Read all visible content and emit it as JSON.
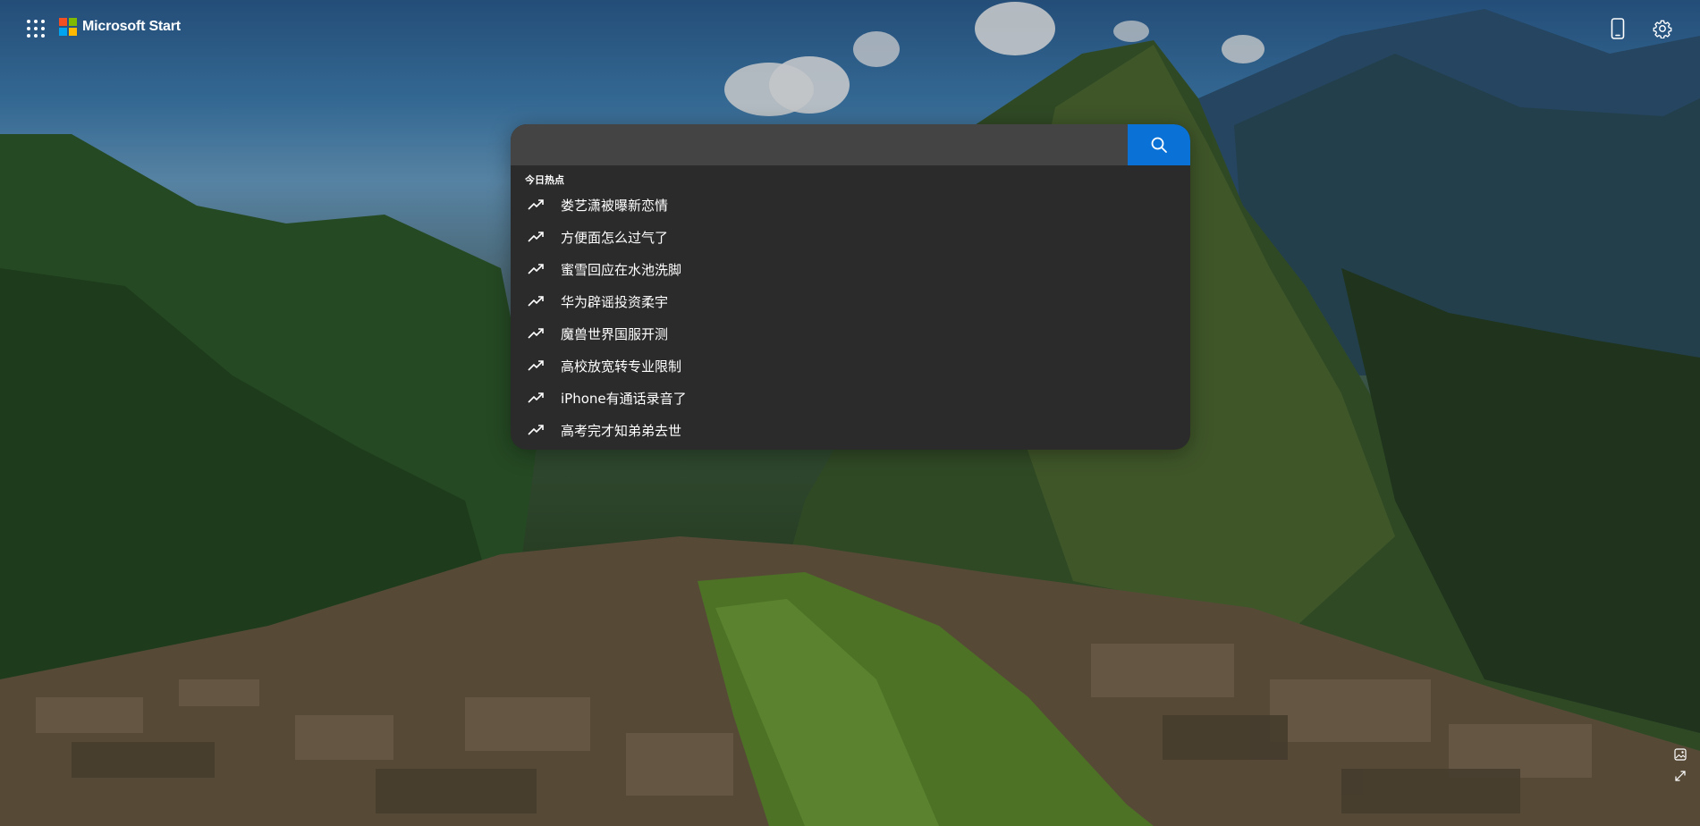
{
  "header": {
    "brand_name": "Microsoft Start",
    "apps_icon": "app-launcher-grid-icon",
    "phone_icon": "mobile-phone-icon",
    "settings_icon": "gear-icon",
    "logo_colors": [
      "#f25022",
      "#7fba00",
      "#00a4ef",
      "#ffb900"
    ]
  },
  "search": {
    "value": "",
    "placeholder": "",
    "button_icon": "search-icon",
    "button_color": "#0a72d6"
  },
  "trending": {
    "title": "今日热点",
    "item_icon": "trending-up-arrow-icon",
    "items": [
      {
        "label": "娄艺潇被曝新恋情"
      },
      {
        "label": "方便面怎么过气了"
      },
      {
        "label": "蜜雪回应在水池洗脚"
      },
      {
        "label": "华为辟谣投资柔宇"
      },
      {
        "label": "魔兽世界国服开测"
      },
      {
        "label": "高校放宽转专业限制"
      },
      {
        "label": "iPhone有通话录音了"
      },
      {
        "label": "高考完才知弟弟去世"
      }
    ]
  },
  "corner_tools": {
    "image_info_icon": "image-icon",
    "expand_icon": "expand-arrows-icon"
  }
}
